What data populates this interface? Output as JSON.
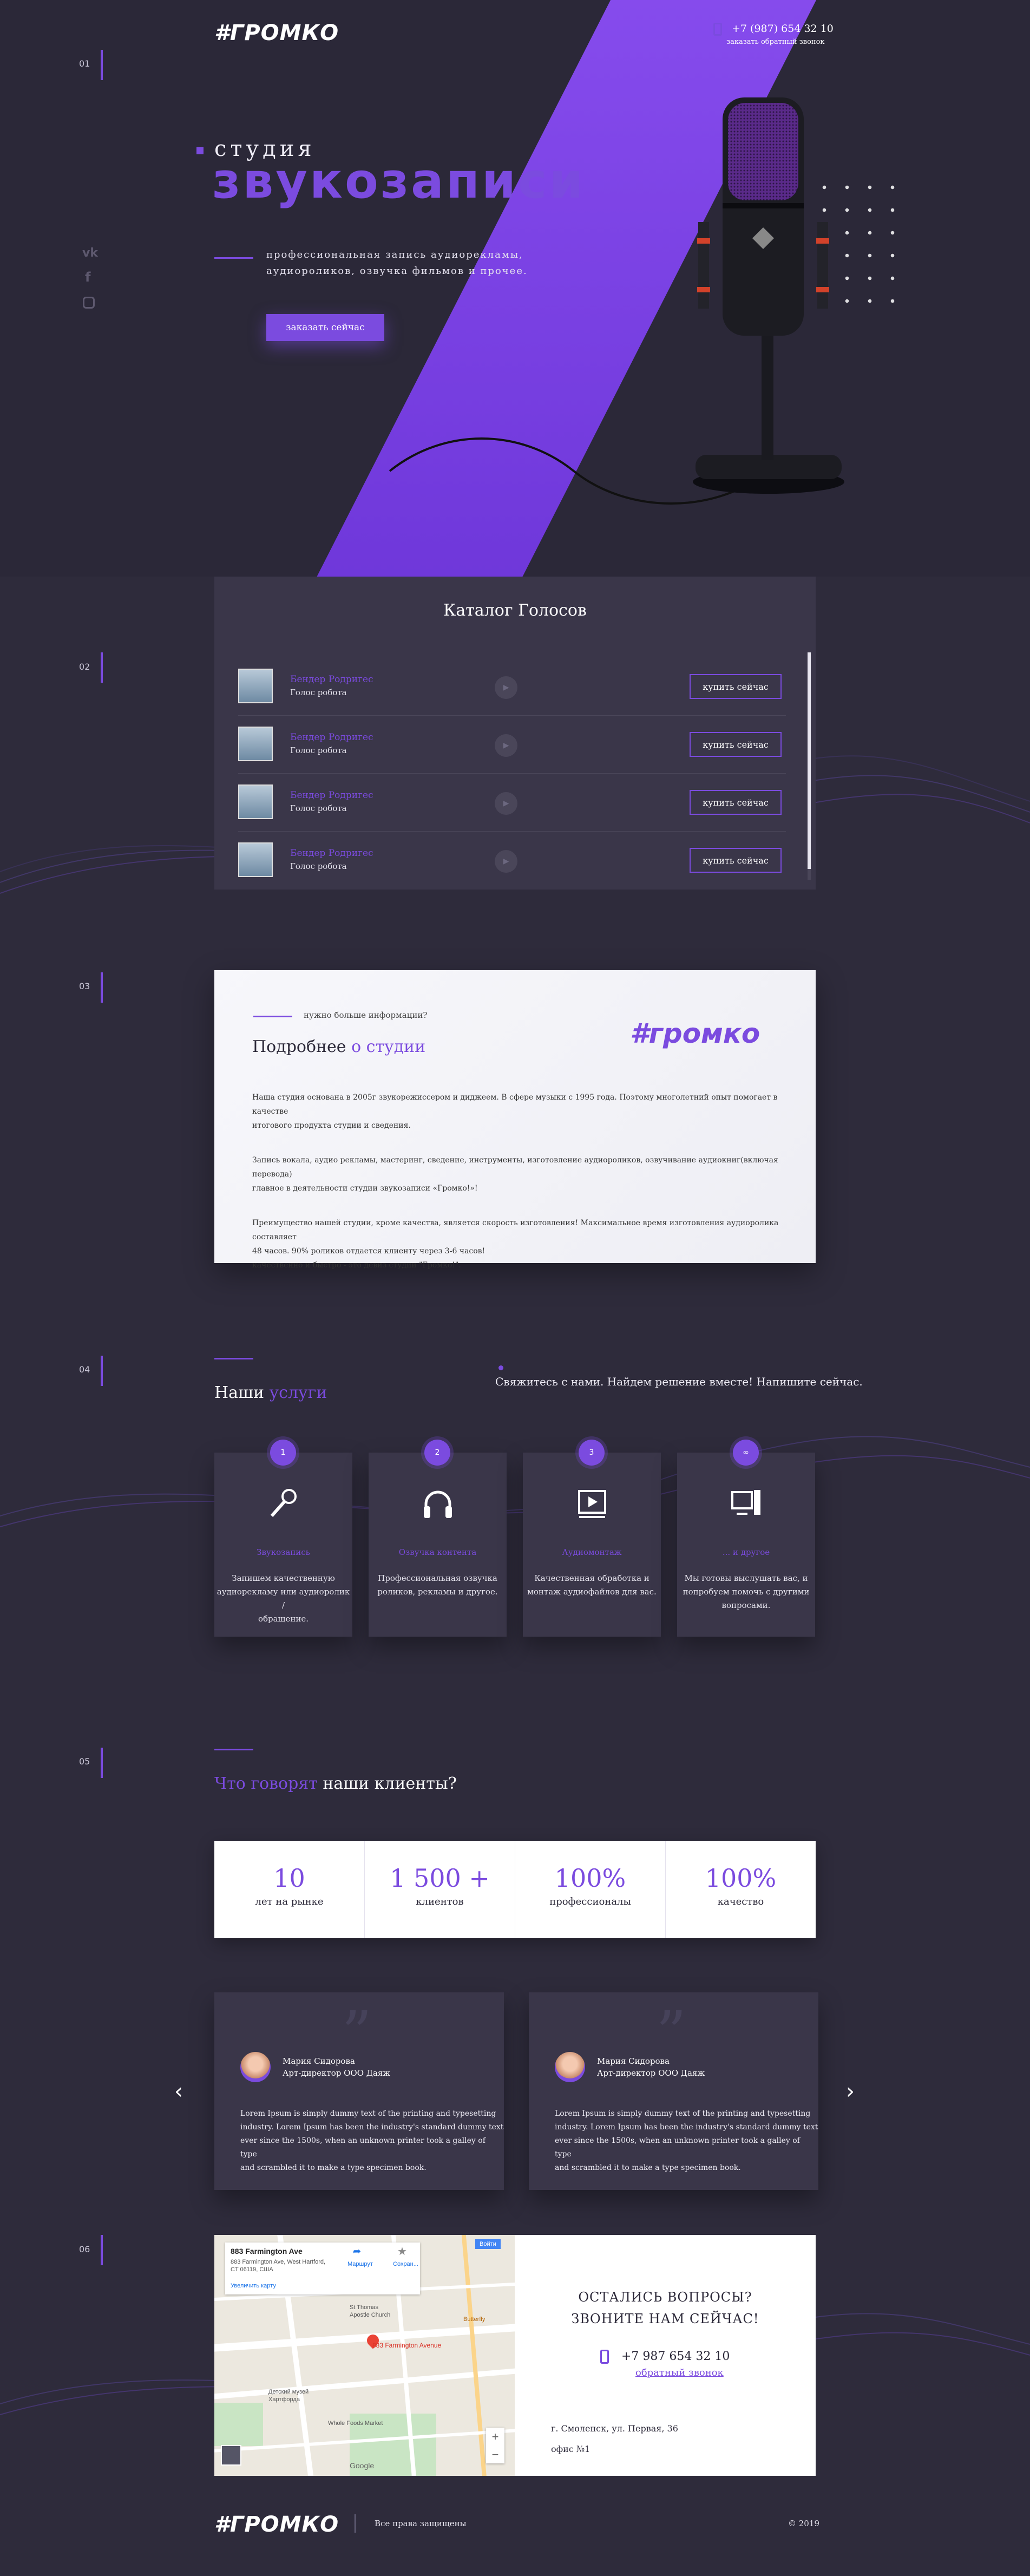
{
  "header": {
    "logo": "#ГРОМКО",
    "phone": "+7 (987) 654 32 10",
    "callback": "заказать обратный звонок"
  },
  "sections": {
    "n1": "01",
    "n2": "02",
    "n3": "03",
    "n4": "04",
    "n5": "05",
    "n6": "06"
  },
  "hero": {
    "kicker": "студия",
    "title": "звукозаписи",
    "description_line1": "профессиональная запись аудиорекламы,",
    "description_line2": "аудиороликов, озвучка фильмов и прочее.",
    "cta": "заказать сейчас"
  },
  "catalog": {
    "title": "Каталог Голосов",
    "rows": [
      {
        "name": "Бендер Родригес",
        "type": "Голос робота",
        "button": "купить сейчас"
      },
      {
        "name": "Бендер Родригес",
        "type": "Голос робота",
        "button": "купить сейчас"
      },
      {
        "name": "Бендер Родригес",
        "type": "Голос робота",
        "button": "купить сейчас"
      },
      {
        "name": "Бендер Родригес",
        "type": "Голос робота",
        "button": "купить сейчас"
      }
    ]
  },
  "about": {
    "kicker": "нужно больше информации?",
    "title_plain": "Подробнее ",
    "title_accent": "о студии",
    "logo": "#громко",
    "p1a": "Наша студия основана в 2005г звукорежиссером и диджеем. В сфере музыки с 1995 года. Поэтому многолетний опыт помогает в качестве",
    "p1b": "итогового продукта студии и сведения.",
    "p2a": "Запись вокала, аудио рекламы, мастеринг, сведение, инструменты, изготовление аудиороликов, озвучивание аудиокниг(включая перевода)",
    "p2b": "главное в деятельности студии звукозаписи «Громко!»!",
    "p3a": "Преимущество нашей студии, кроме качества, является скорость изготовления! Максимальное время изготовления аудиоролика составляет",
    "p3b": "48 часов. 90% роликов отдается клиенту через 3-6 часов!",
    "p3c": "качественно и быстро - это девиз студии \"Громко!\"."
  },
  "services": {
    "title_plain": "Наши ",
    "title_accent": "услуги",
    "contact": "Свяжитесь с нами. Найдем решение вместе! Напишите сейчас.",
    "items": [
      {
        "num": "1",
        "title": "Звукозапись",
        "text_l1": "Запишем качественную",
        "text_l2": "аудиорекламу или аудиоролик /",
        "text_l3": "обращение."
      },
      {
        "num": "2",
        "title": "Озвучка контента",
        "text_l1": "Профессиональная озвучка",
        "text_l2": "роликов, рекламы и другое.",
        "text_l3": ""
      },
      {
        "num": "3",
        "title": "Аудиомонтаж",
        "text_l1": "Качественная обработка и",
        "text_l2": "монтаж аудиофайлов для вас.",
        "text_l3": ""
      },
      {
        "num": "∞",
        "title": "... и другое",
        "text_l1": "Мы готовы выслушать вас, и",
        "text_l2": "попробуем помочь с другими",
        "text_l3": "вопросами."
      }
    ]
  },
  "reviews": {
    "title_accent": "Что говорят",
    "title_plain": " наши клиенты?",
    "stats": [
      {
        "value": "10",
        "label": "лет на рынке"
      },
      {
        "value": "1 500 +",
        "label": "клиентов"
      },
      {
        "value": "100%",
        "label": "профессионалы"
      },
      {
        "value": "100%",
        "label": "качество"
      }
    ],
    "items": [
      {
        "name": "Мария Сидорова",
        "role": "Арт-директор ООО Даяж",
        "l1": "Lorem Ipsum is simply dummy text of the printing and typesetting",
        "l2": "industry. Lorem Ipsum has been the industry's standard dummy text",
        "l3": "ever since the 1500s, when an unknown printer took a galley of type",
        "l4": "and scrambled it to make a type specimen book."
      },
      {
        "name": "Мария Сидорова",
        "role": "Арт-директор ООО Даяж",
        "l1": "Lorem Ipsum is simply dummy text of the printing and typesetting",
        "l2": "industry. Lorem Ipsum has been the industry's standard dummy text",
        "l3": "ever since the 1500s, when an unknown printer took a galley of type",
        "l4": "and scrambled it to make a type specimen book."
      }
    ]
  },
  "contacts": {
    "q1": "ОСТАЛИСЬ ВОПРОСЫ?",
    "q2": "ЗВОНИТЕ НАМ СЕЙЧАС!",
    "phone": "+7 987 654 32 10",
    "callback": "обратный звонок",
    "addr1": "г. Смоленск, ул. Первая, 36",
    "addr2": "офис №1",
    "map": {
      "place": "883 Farmington Ave",
      "addr1": "883 Farmington Ave, West Hartford,",
      "addr2": "CT 06119, США",
      "route": "Маршрут",
      "save": "Сохран...",
      "bigger": "Увеличить карту",
      "marker": "883 Farmington Avenue",
      "poi1": "St Thomas",
      "poi2": "Apostle Church",
      "poi3": "Butterfly",
      "poi4": "Whole Foods Market",
      "poi5": "Детский музей",
      "poi6": "Хартфорда",
      "zoom_in": "+",
      "zoom_out": "−",
      "google": "Google",
      "signin": "Войти"
    }
  },
  "footer": {
    "logo": "#ГРОМКО",
    "rights": "Все права защищены",
    "year": "© 2019"
  }
}
